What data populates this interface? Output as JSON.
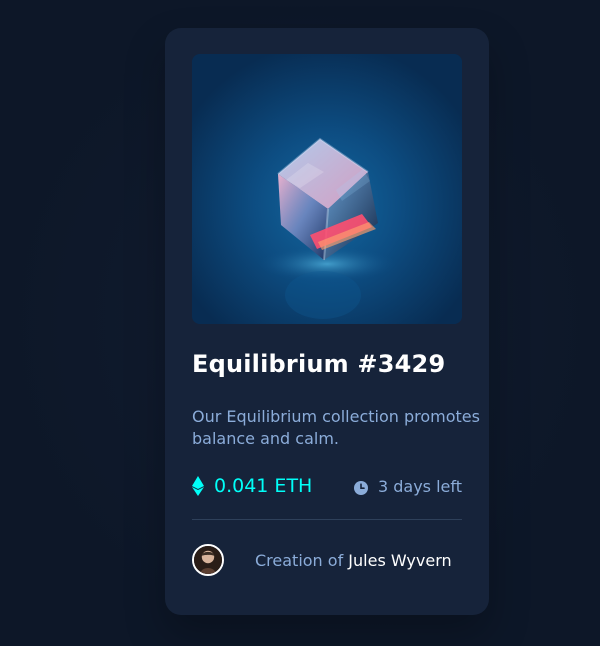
{
  "card": {
    "image_alt": "Equilibrium",
    "title": "Equilibrium #3429",
    "description": "Our Equilibrium collection promotes balance and calm.",
    "price": "0.041 ETH",
    "time_left": "3 days left",
    "creator_prefix": "Creation of ",
    "creator_name": "Jules Wyvern"
  },
  "icons": {
    "price": "ethereum-icon",
    "time": "clock-icon",
    "avatar": "avatar"
  },
  "colors": {
    "page_bg": "#0d1728",
    "card_bg": "#16233a",
    "accent_cyan": "#00fff8",
    "soft_blue": "#8bacd9",
    "white": "#ffffff",
    "divider": "#2e405a"
  }
}
